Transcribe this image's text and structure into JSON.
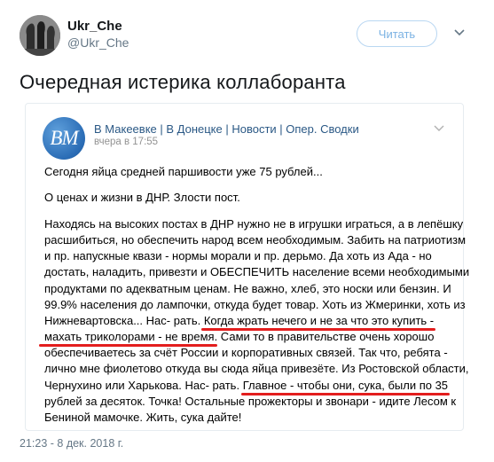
{
  "author": {
    "name": "Ukr_Che",
    "handle": "@Ukr_Che",
    "avatar_icon": "tree-silhouette-avatar"
  },
  "follow_label": "Читать",
  "tweet_text": "Очередная истерика коллаборанта",
  "card": {
    "group_name": "В Макеевке | В Донецке | Новости | Опер. Сводки",
    "logo_text": "ВМ",
    "time": "вчера в 17:55",
    "lines": {
      "l1": "Сегодня яйца средней паршивости уже 75 рублей...",
      "l2": "О ценах и жизни в ДНР. Злости пост.",
      "l3": "Находясь на высоких постах в ДНР нужно не в игрушки играться, а в лепёшку",
      "l4": "расшибиться, но обеспечить народ всем необходимым. Забить на патриотизм",
      "l5": "и пр. напускные квази - нормы морали и пр. дерьмо. Да хоть из Ада - но",
      "l6": "достать, наладить, привезти и ОБЕСПЕЧИТЬ население всеми необходимыми",
      "l7": "продуктами по адекватным ценам. Не важно, хлеб, это носки или бензин. И",
      "l8": "99.9% населения до лампочки, откуда будет товар. Хоть из Жмеринки, хоть из",
      "l9a": "Нижневартовска... Нас- рать. ",
      "l9b": "Когда жрать нечего и не за что это купить -",
      "l10a": "махать триколорами - не время",
      "l10b": ". Сами то в правительстве очень хорошо",
      "l11": "обеспечиваетесь за счёт России и корпоративных связей. Так что, ребята -",
      "l12": "лично мне фиолетово откуда вы сюда яйца привезёте. Из Ростовской области,",
      "l13a": "Чернухино или Харькова. Нас- рать. ",
      "l13b": "Главное - чтобы они, сука, были по 35",
      "l14a": "рублей за десяток",
      "l14b": ". Точка! Остальные прожекторы и звонари - идите Лесом к",
      "l15": "Бениной мамочке. Жить, сука дайте!"
    }
  },
  "footer_date": "21:23 - 8 дек. 2018 г.",
  "colors": {
    "link_blue": "#2a5885",
    "underline_red": "#e31e1e",
    "follow_blue": "#7bb2e3"
  }
}
